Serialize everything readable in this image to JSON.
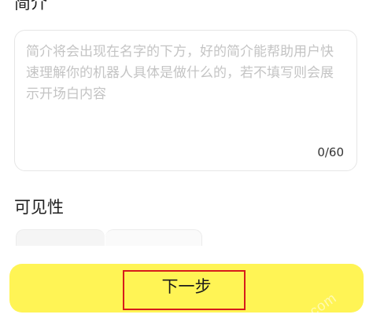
{
  "description": {
    "title": "简介",
    "placeholder": "简介将会出现在名字的下方，好的简介能帮助用户快速理解你的机器人具体是做什么的，若不填写则会展示开场白内容",
    "value": "",
    "char_count": "0/60"
  },
  "visibility": {
    "title": "可见性"
  },
  "footer": {
    "next_label": "下一步"
  },
  "watermark": "nz.com"
}
